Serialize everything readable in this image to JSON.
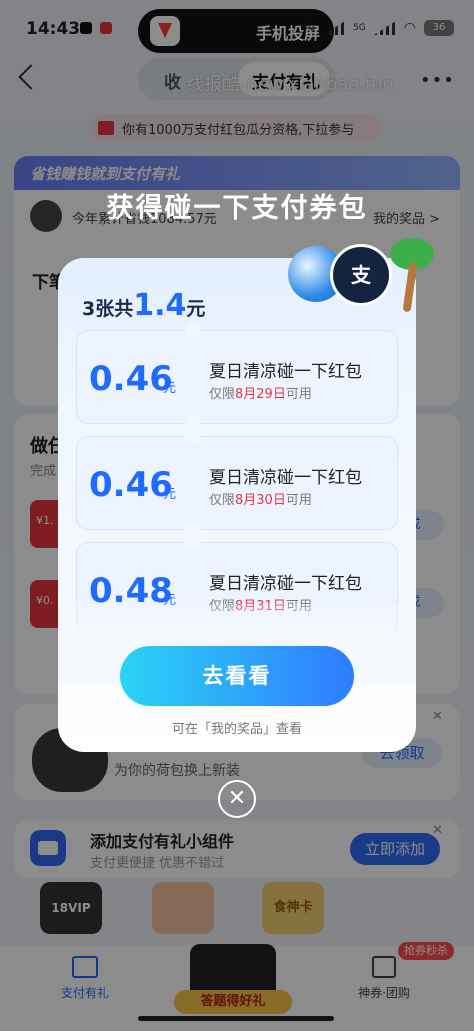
{
  "status_bar": {
    "time": "14:43",
    "island_label": "手机投屏",
    "network_1": "5G",
    "network_2": "5G",
    "battery": "36"
  },
  "nav": {
    "tab_1": "收",
    "tab_2": "支付有礼",
    "more": "•••",
    "watermark": "线报酷-new.xianbao.fun"
  },
  "background": {
    "red_banner": "你有1000万支付红包瓜分资格,下拉参与",
    "promo_head": "省钱赚钱就到支付有礼",
    "promo_total": "今年累计省钱1084.57元",
    "my_prizes": "我的奖品 >",
    "order_label": "下笔",
    "task_title": "做任",
    "task_sub": "完成",
    "task_chip_1": "¥1.",
    "task_chip_2": "¥0.",
    "task_btn": "成",
    "skin_text": "为你的荷包换上新装",
    "skin_btn": "去领取",
    "widget_title": "添加支付有礼小组件",
    "widget_sub": "支付更便捷 优惠不错过",
    "widget_btn": "立即添加",
    "vip_chip": "18VIP",
    "food_chip": "食神卡",
    "close_x": "✕"
  },
  "tab_bar": {
    "gift_label": "支付有礼",
    "quiz_label": "答题得好礼",
    "coupon_label": "神券·团购",
    "coupon_badge": "抢券秒杀"
  },
  "modal": {
    "title": "获得碰一下支付券包",
    "summary_prefix": "3张共",
    "summary_amount": "1.4",
    "summary_suffix": "元",
    "alipay_glyph": "支",
    "coupons": [
      {
        "amount": "0.46",
        "unit": "元",
        "name": "夏日清凉碰一下红包",
        "limit_prefix": "仅限",
        "date": "8月29日",
        "limit_suffix": "可用"
      },
      {
        "amount": "0.46",
        "unit": "元",
        "name": "夏日清凉碰一下红包",
        "limit_prefix": "仅限",
        "date": "8月30日",
        "limit_suffix": "可用"
      },
      {
        "amount": "0.48",
        "unit": "元",
        "name": "夏日清凉碰一下红包",
        "limit_prefix": "仅限",
        "date": "8月31日",
        "limit_suffix": "可用"
      }
    ],
    "cta_label": "去看看",
    "hint": "可在「我的奖品」查看",
    "close_glyph": "✕"
  },
  "colors": {
    "accent_blue": "#1f6bff",
    "date_red": "#e8353f",
    "overlay": "rgba(0,0,0,0.45)"
  }
}
